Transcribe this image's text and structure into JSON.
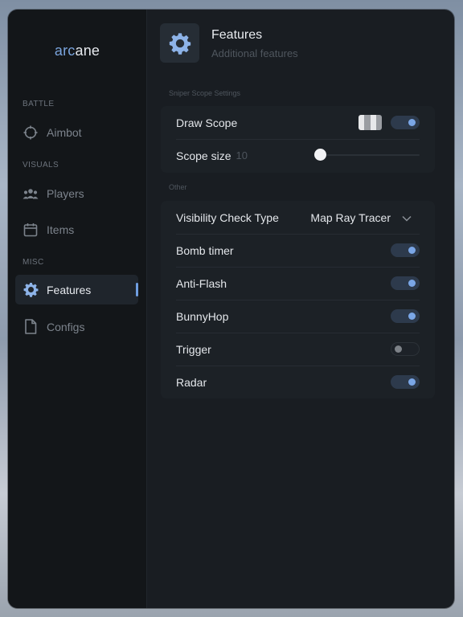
{
  "app": {
    "logo_part1": "arc",
    "logo_part2": "ane"
  },
  "sidebar": {
    "sections": {
      "battle": "BATTLE",
      "visuals": "VISUALS",
      "misc": "MISC"
    },
    "items": [
      {
        "label": "Aimbot",
        "icon": "crosshair-icon"
      },
      {
        "label": "Players",
        "icon": "players-icon"
      },
      {
        "label": "Items",
        "icon": "calendar-icon"
      },
      {
        "label": "Features",
        "icon": "gear-icon",
        "active": true
      },
      {
        "label": "Configs",
        "icon": "document-icon"
      }
    ]
  },
  "header": {
    "icon": "gear-icon",
    "title": "Features",
    "subtitle": "Additional features"
  },
  "sniper": {
    "group_label": "Sniper Scope Settings",
    "draw_scope": {
      "label": "Draw Scope",
      "enabled": true
    },
    "scope_size": {
      "label": "Scope size",
      "value": "10",
      "fraction": 0.0
    }
  },
  "other": {
    "group_label": "Other",
    "visibility": {
      "label": "Visibility Check Type",
      "value": "Map Ray Tracer"
    },
    "toggles": [
      {
        "label": "Bomb timer",
        "enabled": true
      },
      {
        "label": "Anti-Flash",
        "enabled": true
      },
      {
        "label": "BunnyHop",
        "enabled": true
      },
      {
        "label": "Trigger",
        "enabled": false
      },
      {
        "label": "Radar",
        "enabled": true
      }
    ]
  },
  "colors": {
    "accent": "#7aa6e6",
    "panel": "#191d22",
    "sidebar": "#131619"
  }
}
